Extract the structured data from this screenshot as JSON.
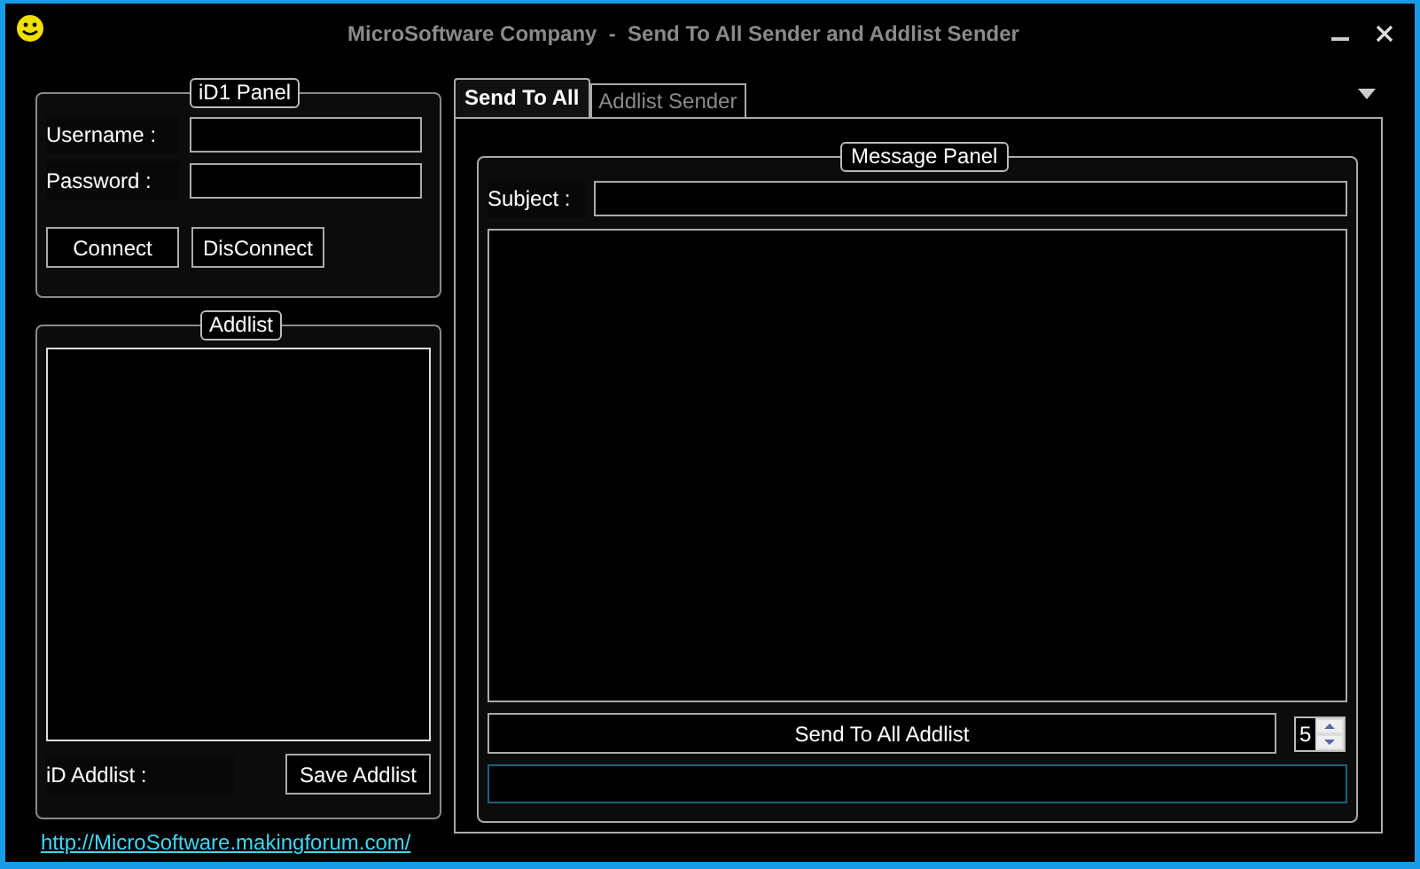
{
  "window": {
    "title": "MicroSoftware Company  -  Send To All Sender and Addlist Sender"
  },
  "id_panel": {
    "title": "iD1 Panel",
    "fields": [
      {
        "label": "Username :"
      },
      {
        "label": "Password :"
      }
    ],
    "buttons": [
      "Connect",
      "DisConnect"
    ]
  },
  "addlist_panel": {
    "title": "Addlist",
    "id_label": "iD Addlist :",
    "save_button": "Save Addlist"
  },
  "link": "http://MicroSoftware.makingforum.com/",
  "tabs": [
    {
      "label": "Send To All",
      "selected": true
    },
    {
      "label": "Addlist Sender",
      "selected": false
    }
  ],
  "message_panel": {
    "title": "Message Panel",
    "subject_label": "Subject :",
    "send_button": "Send To All Addlist",
    "count": "5"
  }
}
